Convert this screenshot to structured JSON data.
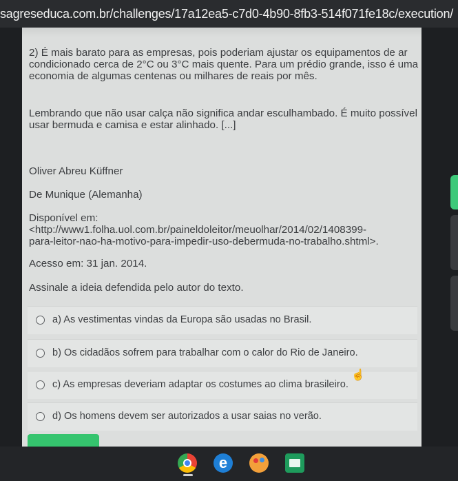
{
  "browser": {
    "url": "sagreseduca.com.br/challenges/17a12ea5-c7d0-4b90-8fb3-514f071fe18c/execution/"
  },
  "content": {
    "paragraph_2": "2) É mais barato para as empresas, pois poderiam ajustar os equipamentos de ar condicionado cerca de 2°C ou 3°C mais quente. Para um prédio grande, isso é uma economia de algumas centenas ou milhares de reais por mês.",
    "paragraph_3": "Lembrando que não usar calça não significa andar esculhambado. É muito possível usar bermuda e camisa e estar alinhado. [...]",
    "author": "Oliver Abreu Küffner",
    "location": "De Munique (Alemanha)",
    "available_label": "Disponível em:",
    "available_url_1": "<http://www1.folha.uol.com.br/paineldoleitor/meuolhar/2014/02/1408399-",
    "available_url_2": "para-leitor-nao-ha-motivo-para-impedir-uso-debermuda-no-trabalho.shtml>.",
    "access": "Acesso em: 31 jan. 2014.",
    "question": "Assinale a ideia defendida pelo autor do texto."
  },
  "options": [
    {
      "label": "a) As vestimentas vindas da Europa são usadas no Brasil."
    },
    {
      "label": "b) Os cidadãos sofrem para trabalhar com o calor do Rio de Janeiro."
    },
    {
      "label": "c) As empresas deveriam adaptar os costumes ao clima brasileiro."
    },
    {
      "label": "d) Os homens devem ser autorizados a usar saias no verão."
    }
  ],
  "taskbar": {
    "apps": [
      "chrome-icon",
      "edge-icon",
      "paint-icon",
      "classroom-icon"
    ]
  },
  "colors": {
    "accent_green": "#35c46e",
    "page_background": "#dcdedd"
  }
}
